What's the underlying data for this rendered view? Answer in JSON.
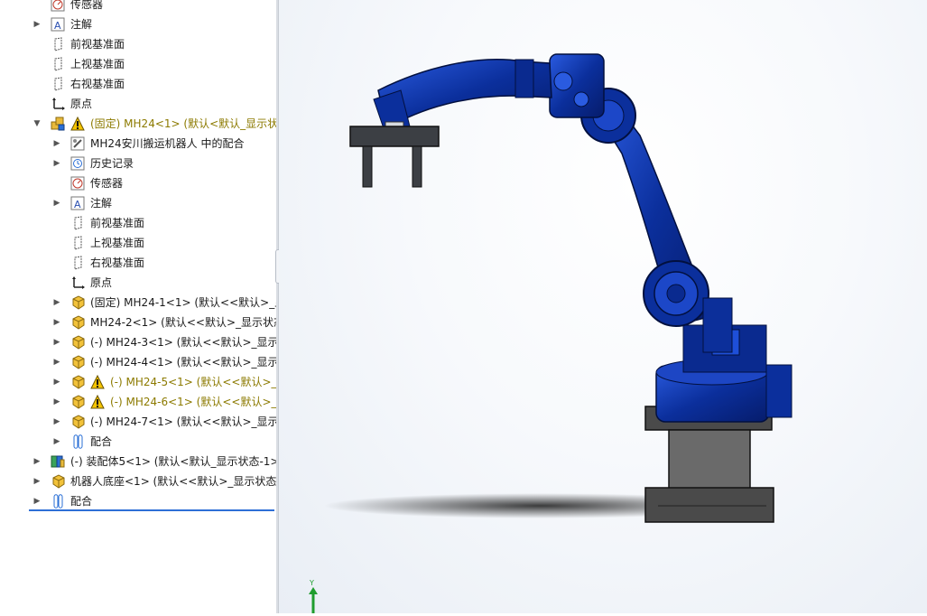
{
  "tree": {
    "items": [
      {
        "label": "传感器",
        "arrow": "",
        "icon": "sensor",
        "indent": 0,
        "warn": false,
        "yellow": false
      },
      {
        "label": "注解",
        "arrow": "▶",
        "icon": "annotation",
        "indent": 0,
        "warn": false,
        "yellow": false
      },
      {
        "label": "前视基准面",
        "arrow": "",
        "icon": "plane",
        "indent": 0,
        "warn": false,
        "yellow": false
      },
      {
        "label": "上视基准面",
        "arrow": "",
        "icon": "plane",
        "indent": 0,
        "warn": false,
        "yellow": false
      },
      {
        "label": "右视基准面",
        "arrow": "",
        "icon": "plane",
        "indent": 0,
        "warn": false,
        "yellow": false
      },
      {
        "label": "原点",
        "arrow": "",
        "icon": "origin",
        "indent": 0,
        "warn": false,
        "yellow": false
      },
      {
        "label": "(固定) MH24<1> (默认<默认_显示状",
        "arrow": "▼",
        "icon": "assembly",
        "indent": 0,
        "warn": true,
        "yellow": true
      },
      {
        "label": "MH24安川搬运机器人 中的配合",
        "arrow": "▶",
        "icon": "mates-folder",
        "indent": 1,
        "warn": false,
        "yellow": false
      },
      {
        "label": "历史记录",
        "arrow": "▶",
        "icon": "history",
        "indent": 1,
        "warn": false,
        "yellow": false
      },
      {
        "label": "传感器",
        "arrow": "",
        "icon": "sensor",
        "indent": 1,
        "warn": false,
        "yellow": false
      },
      {
        "label": "注解",
        "arrow": "▶",
        "icon": "annotation",
        "indent": 1,
        "warn": false,
        "yellow": false
      },
      {
        "label": "前视基准面",
        "arrow": "",
        "icon": "plane",
        "indent": 1,
        "warn": false,
        "yellow": false
      },
      {
        "label": "上视基准面",
        "arrow": "",
        "icon": "plane",
        "indent": 1,
        "warn": false,
        "yellow": false
      },
      {
        "label": "右视基准面",
        "arrow": "",
        "icon": "plane",
        "indent": 1,
        "warn": false,
        "yellow": false
      },
      {
        "label": "原点",
        "arrow": "",
        "icon": "origin",
        "indent": 1,
        "warn": false,
        "yellow": false
      },
      {
        "label": "(固定) MH24-1<1> (默认<<默认>_显",
        "arrow": "▶",
        "icon": "part",
        "indent": 1,
        "warn": false,
        "yellow": false
      },
      {
        "label": "MH24-2<1> (默认<<默认>_显示状态",
        "arrow": "▶",
        "icon": "part",
        "indent": 1,
        "warn": false,
        "yellow": false
      },
      {
        "label": "(-) MH24-3<1> (默认<<默认>_显示",
        "arrow": "▶",
        "icon": "part",
        "indent": 1,
        "warn": false,
        "yellow": false
      },
      {
        "label": "(-) MH24-4<1> (默认<<默认>_显示",
        "arrow": "▶",
        "icon": "part",
        "indent": 1,
        "warn": false,
        "yellow": false
      },
      {
        "label": "(-) MH24-5<1> (默认<<默认>_",
        "arrow": "▶",
        "icon": "part",
        "indent": 1,
        "warn": true,
        "yellow": true
      },
      {
        "label": "(-) MH24-6<1> (默认<<默认>_",
        "arrow": "▶",
        "icon": "part",
        "indent": 1,
        "warn": true,
        "yellow": true
      },
      {
        "label": "(-) MH24-7<1> (默认<<默认>_显示",
        "arrow": "▶",
        "icon": "part",
        "indent": 1,
        "warn": false,
        "yellow": false
      },
      {
        "label": "配合",
        "arrow": "▶",
        "icon": "mates",
        "indent": 1,
        "warn": false,
        "yellow": false
      },
      {
        "label": "(-) 装配体5<1> (默认<默认_显示状态-1>",
        "arrow": "▶",
        "icon": "subassembly",
        "indent": 0,
        "warn": false,
        "yellow": false
      },
      {
        "label": "机器人底座<1> (默认<<默认>_显示状态",
        "arrow": "▶",
        "icon": "part",
        "indent": 0,
        "warn": false,
        "yellow": false
      },
      {
        "label": "配合",
        "arrow": "▶",
        "icon": "mates",
        "indent": 0,
        "warn": false,
        "yellow": false
      }
    ]
  },
  "triad": {
    "y_label": "Y"
  },
  "colors": {
    "robot_blue": "#0b2f9c",
    "robot_dark": "#061c6b",
    "pedestal": "#5a5a5a",
    "gripper": "#3c3f44",
    "warn": "#f5c400",
    "folder": "#e8b93a"
  }
}
